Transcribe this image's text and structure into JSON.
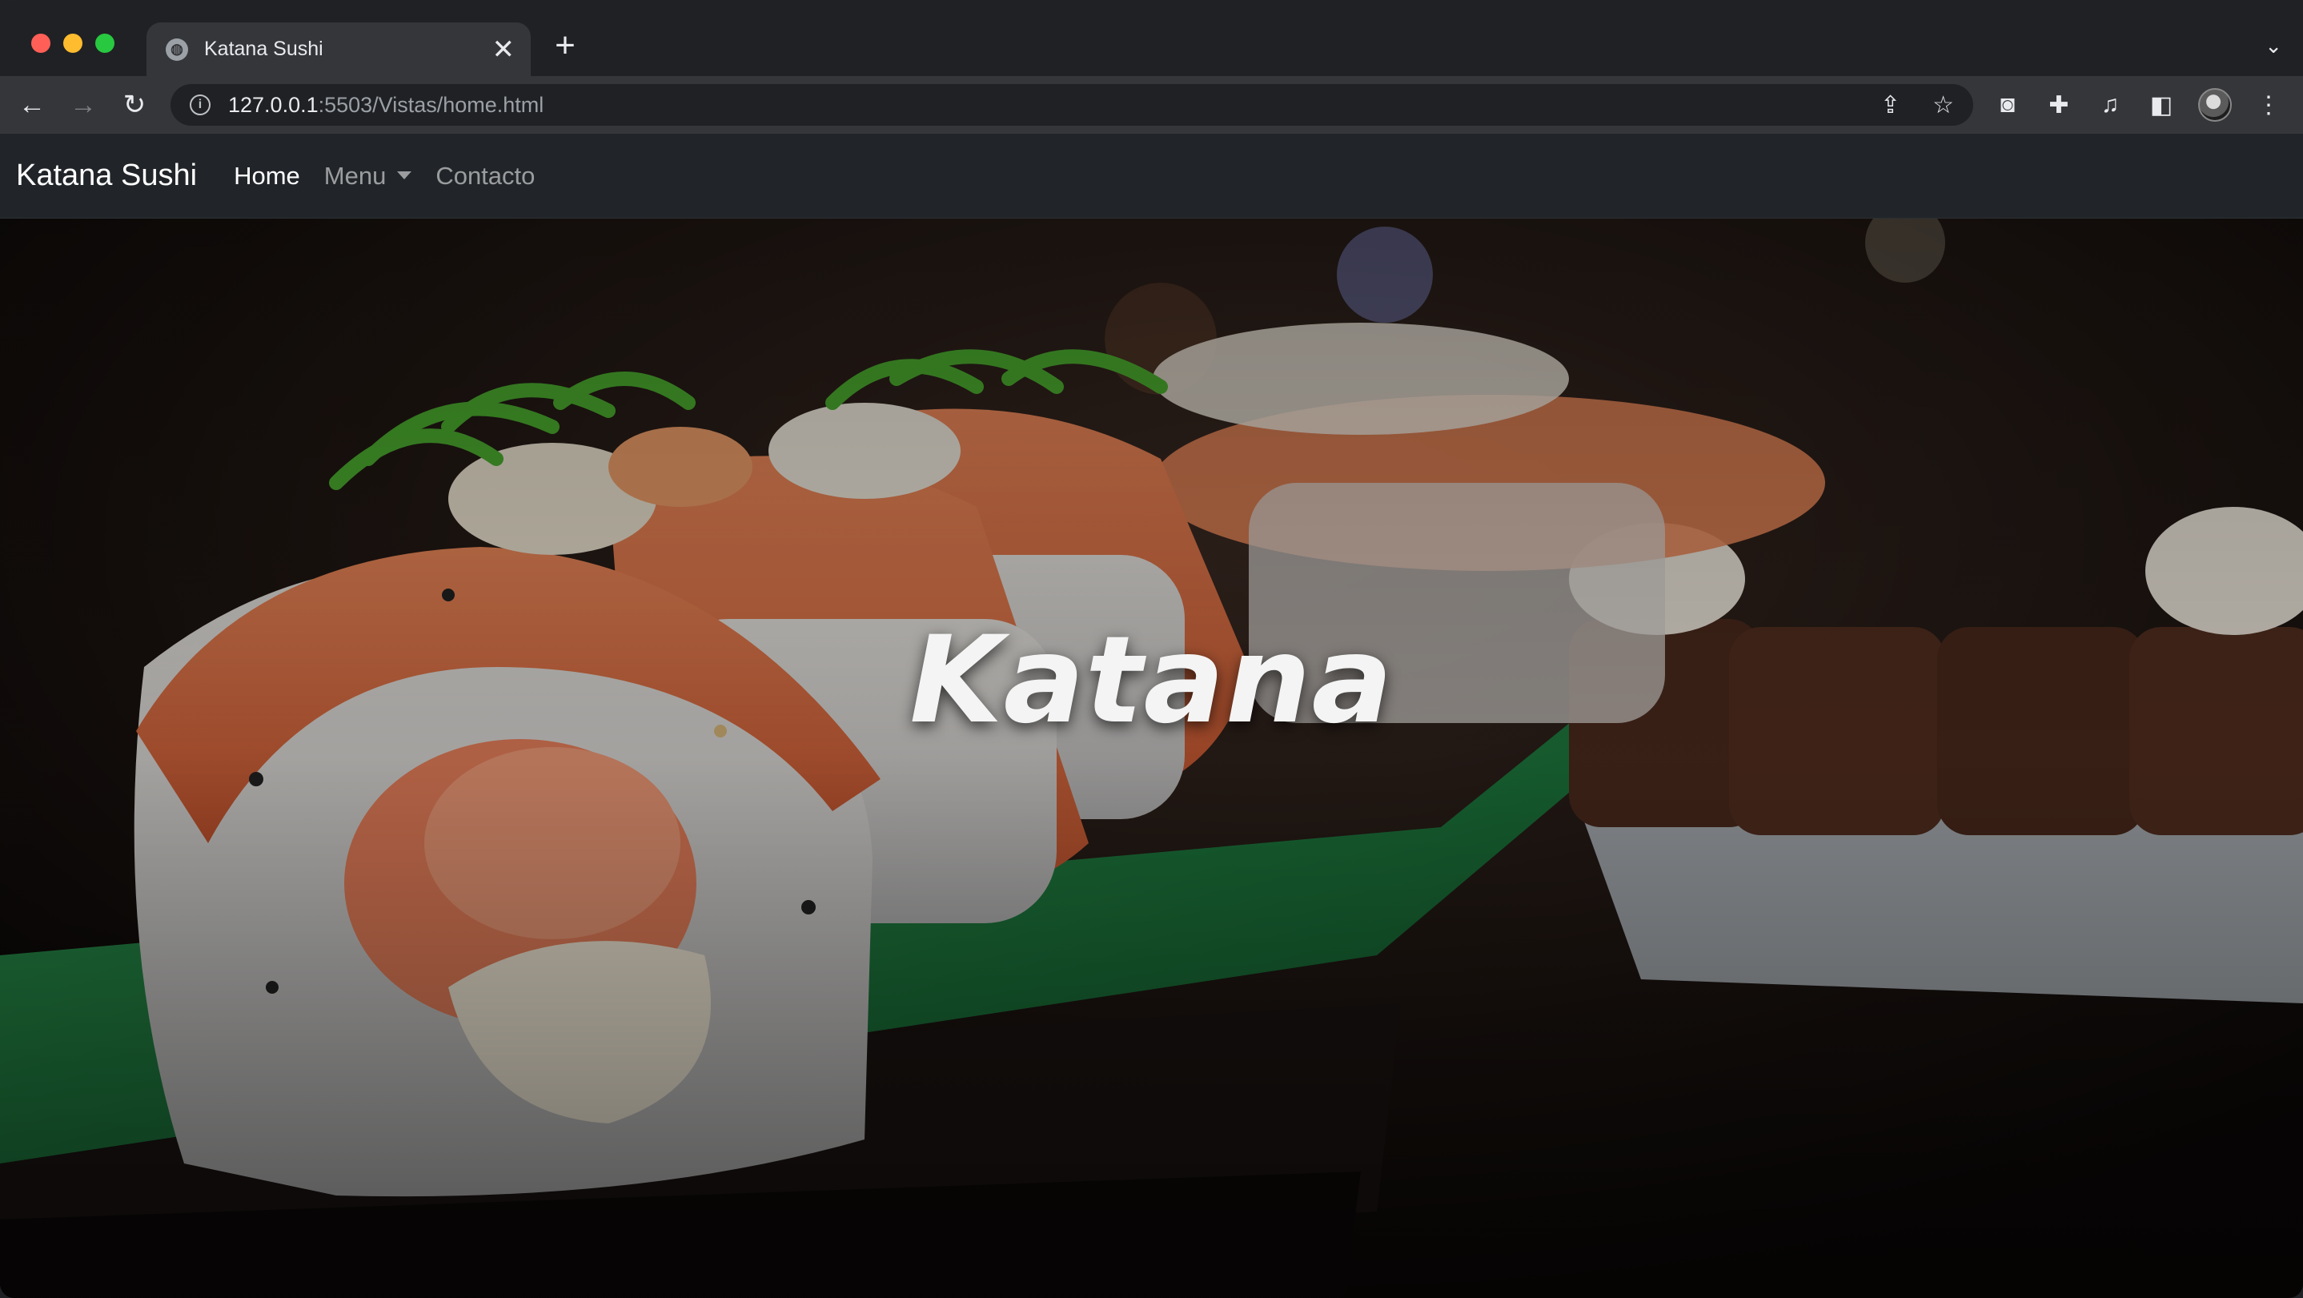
{
  "browser": {
    "tab_title": "Katana Sushi",
    "new_tab_symbol": "+",
    "close_symbol": "✕",
    "url_host": "127.0.0.1",
    "url_rest": ":5503/Vistas/home.html",
    "icons": [
      "back-icon",
      "forward-icon",
      "reload-icon",
      "info-icon",
      "share-icon",
      "bookmark-star-icon",
      "extension-icon",
      "puzzle-icon",
      "media-icon",
      "sidepanel-icon",
      "profile-avatar",
      "menu-kebab-icon",
      "tab-search-icon"
    ]
  },
  "site": {
    "brand": "Katana Sushi",
    "nav": {
      "home": "Home",
      "menu": "Menu",
      "contact": "Contacto"
    },
    "hero_title": "Katana"
  },
  "colors": {
    "navbar_bg": "#212529",
    "nav_active": "#ffffff",
    "nav_inactive": "rgba(255,255,255,0.55)",
    "hero_text": "#f4f4f4"
  }
}
